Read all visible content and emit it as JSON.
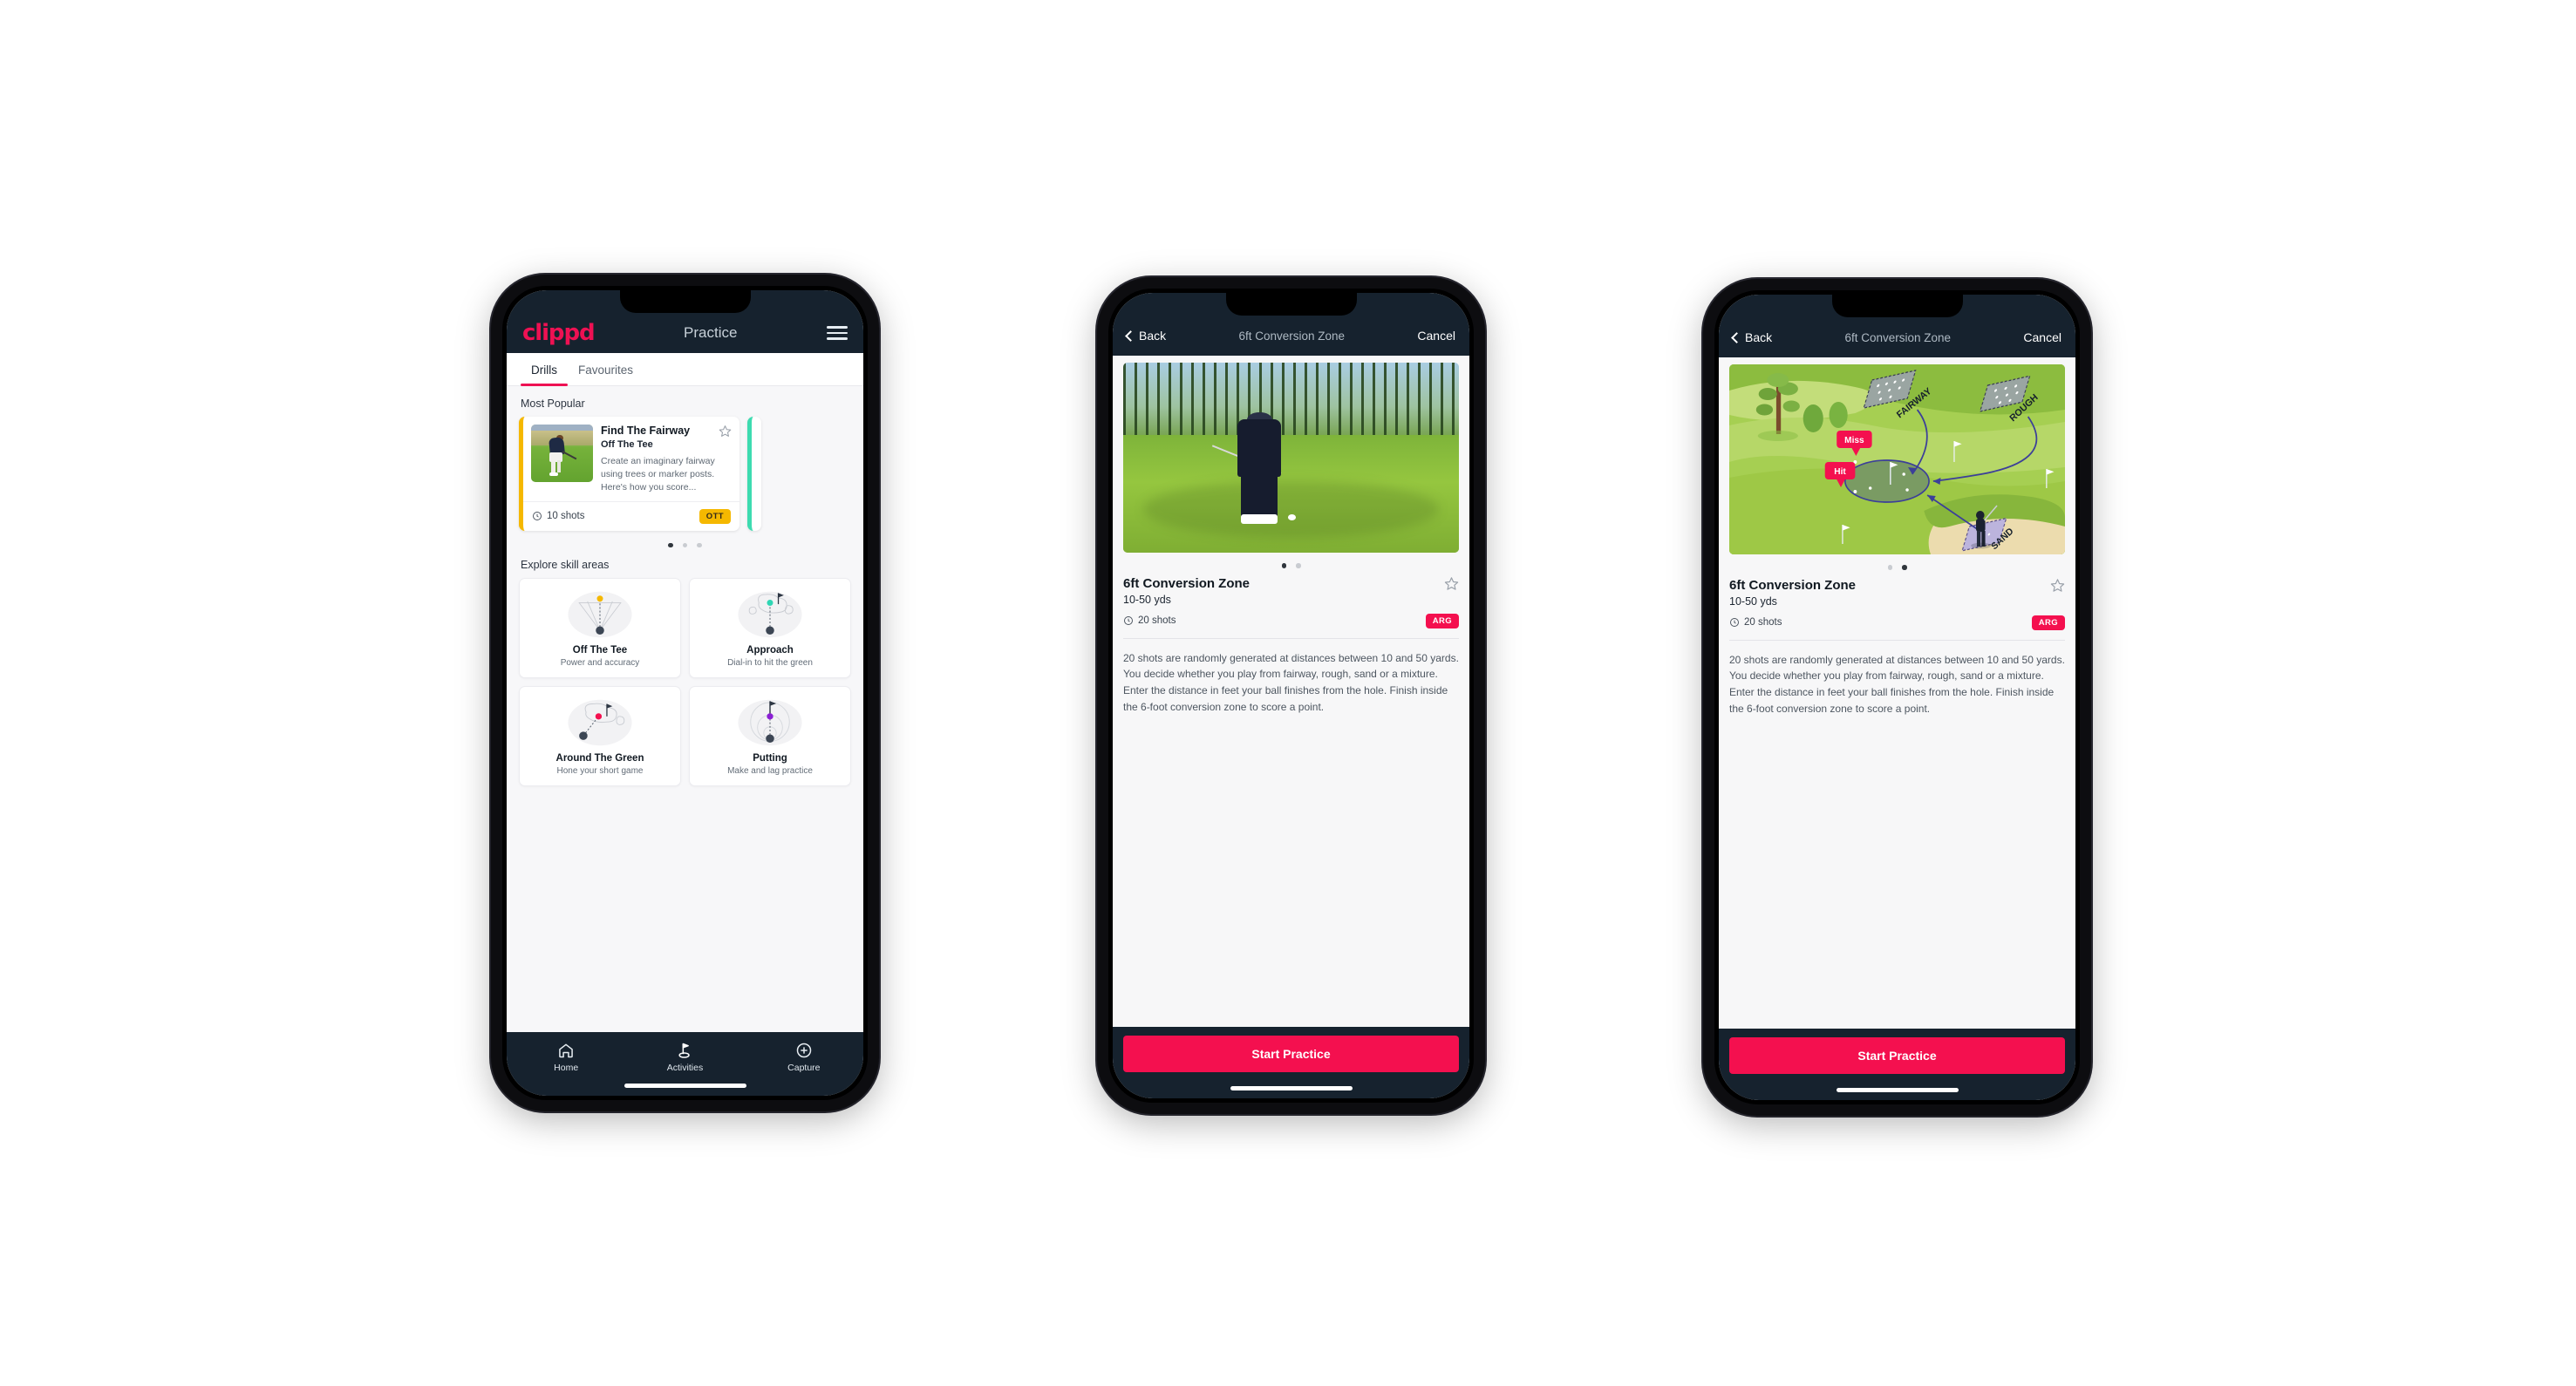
{
  "phone1": {
    "appbar": {
      "logo": "clippd",
      "title": "Practice",
      "menu_icon": "hamburger-icon"
    },
    "tabs": [
      {
        "label": "Drills",
        "active": true
      },
      {
        "label": "Favourites",
        "active": false
      }
    ],
    "most_popular": {
      "section_label": "Most Popular",
      "card": {
        "title": "Find The Fairway",
        "subtitle": "Off The Tee",
        "description": "Create an imaginary fairway using trees or marker posts. Here's how you score...",
        "shots": "10 shots",
        "badge": "OTT",
        "accent_color": "#f5b800",
        "favourite_icon": "star-outline-icon"
      },
      "next_card_accent_color": "#3ddbb0",
      "dots": {
        "count": 3,
        "active_index": 0
      }
    },
    "explore": {
      "section_label": "Explore skill areas",
      "skills": [
        {
          "title": "Off The Tee",
          "subtitle": "Power and accuracy",
          "icon": "tee-dispersion-icon",
          "dot_color": "#f5b800"
        },
        {
          "title": "Approach",
          "subtitle": "Dial-in to hit the green",
          "icon": "approach-green-icon",
          "dot_color": "#2fd6b4"
        },
        {
          "title": "Around The Green",
          "subtitle": "Hone your short game",
          "icon": "chip-green-icon",
          "dot_color": "#f4104f"
        },
        {
          "title": "Putting",
          "subtitle": "Make and lag practice",
          "icon": "putting-rings-icon",
          "dot_color": "#8b1fd4"
        }
      ]
    },
    "tabbar": [
      {
        "label": "Home",
        "icon": "home-icon",
        "active": false
      },
      {
        "label": "Activities",
        "icon": "golf-flag-icon",
        "active": true
      },
      {
        "label": "Capture",
        "icon": "plus-circle-icon",
        "active": false
      }
    ]
  },
  "detail": {
    "nav": {
      "back": "Back",
      "title": "6ft Conversion Zone",
      "cancel": "Cancel",
      "back_icon": "chevron-left-icon"
    },
    "title": "6ft Conversion Zone",
    "yards": "10-50 yds",
    "shots": "20 shots",
    "badge": "ARG",
    "badge_color": "#f4104f",
    "favourite_icon": "star-outline-icon",
    "description": "20 shots are randomly generated at distances between 10 and 50 yards. You decide whether you play from fairway, rough, sand or a mixture. Enter the distance in feet your ball finishes from the hole. Finish inside the 6-foot conversion zone to score a point.",
    "cta": "Start Practice"
  },
  "phone2": {
    "hero": {
      "type": "photo",
      "alt": "golfer-chipping-photo"
    },
    "dots": {
      "count": 2,
      "active_index": 0
    }
  },
  "phone3": {
    "hero": {
      "type": "illustration",
      "alt": "golf-course-diagram",
      "labels": {
        "fairway": "FAIRWAY",
        "rough": "ROUGH",
        "sand": "SAND"
      },
      "markers": {
        "miss": "Miss",
        "hit": "Hit"
      }
    },
    "dots": {
      "count": 2,
      "active_index": 1
    }
  },
  "theme": {
    "brand_pink": "#ee1153",
    "cta_pink": "#f4104f",
    "navy": "#16222e",
    "amber": "#f5b800",
    "teal": "#3ddbb0",
    "page_bg": "#ffffff"
  }
}
